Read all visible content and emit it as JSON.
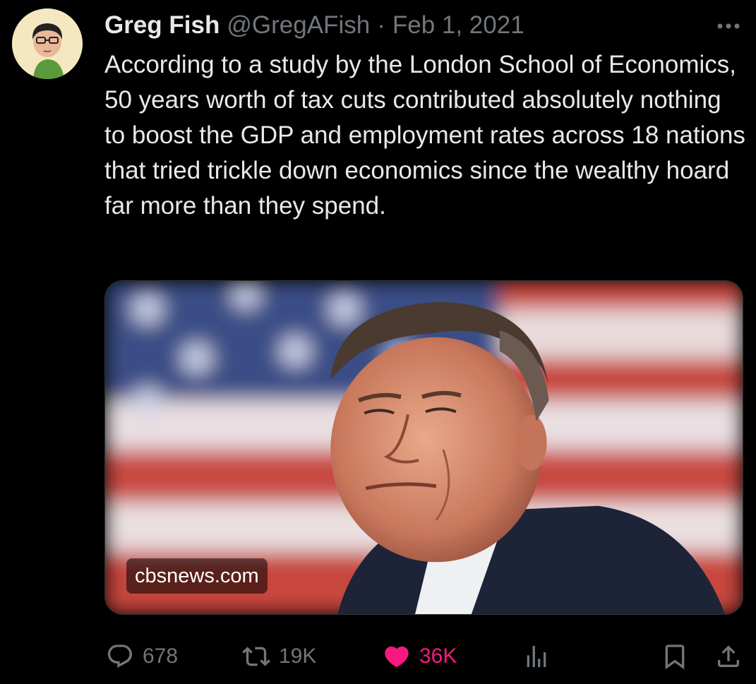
{
  "author": {
    "display_name": "Greg Fish",
    "handle": "@GregAFish",
    "separator": "·",
    "date": "Feb 1, 2021",
    "avatar_icon": "cartoon-avatar"
  },
  "tweet": {
    "text": "According to a study by the London School of Economics, 50 years worth of tax cuts contributed absolutely nothing to boost the GDP and employment rates across 18 nations that tried trickle down economics since the wealthy hoard far more than they spend."
  },
  "media": {
    "domain": "cbsnews.com",
    "image": "photo of an older man in a suit in front of an American flag"
  },
  "actions": {
    "reply_count": "678",
    "retweet_count": "19K",
    "like_count": "36K",
    "liked": true,
    "like_color": "#f91880"
  },
  "colors": {
    "background": "#000000",
    "primary_text": "#e7e9ea",
    "secondary_text": "#71767b"
  }
}
